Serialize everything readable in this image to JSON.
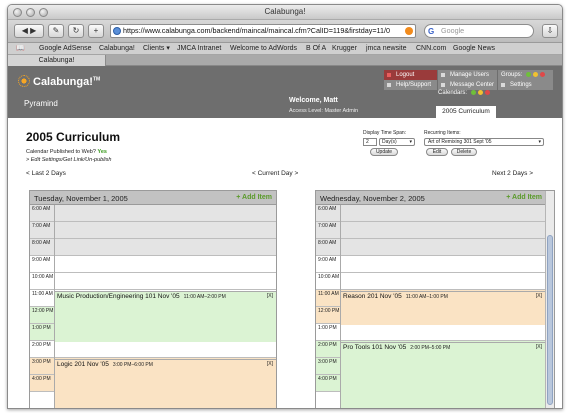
{
  "window": {
    "title": "Calabunga!"
  },
  "toolbar": {
    "url": "https://www.calabunga.com/backend/maincal/maincal.cfm?CalID=119&firstday=11/0",
    "search_placeholder": "Google"
  },
  "bookmarks": [
    "Google AdSense",
    "Calabunga!",
    "Clients ▾",
    "JMCA Intranet",
    "Welcome to AdWords",
    "B Of A",
    "Krugger",
    "jmca newsite",
    "CNN.com",
    "Google News"
  ],
  "tab": {
    "label": "Calabunga!"
  },
  "header": {
    "logo": "Calabunga!",
    "logo_tm": "TM",
    "org": "Pyramind",
    "welcome": "Welcome, Matt",
    "access": "Access Level: Master Admin",
    "menu": {
      "logout": "Logout",
      "help": "Help/Support",
      "manage_users": "Manage Users",
      "message_center": "Message Center",
      "groups": "Groups:",
      "settings": "Settings",
      "calendars": "Calendars:"
    },
    "current_calendar": "2005 Curriculum"
  },
  "main": {
    "title": "2005 Curriculum",
    "published_label": "Calendar Published to Web?",
    "published_value": "Yes",
    "edit_link": "> Edit Settings/Get Link/Un-publish",
    "display_span_label": "Display Time Span:",
    "display_span_num": "2",
    "display_span_unit": "Day(s)",
    "update_button": "Update",
    "recurring_label": "Recurring Items:",
    "recurring_value": "Art of Remixing 301 Sept '05",
    "edit_button": "Edit",
    "delete_button": "Delete",
    "nav_prev": "< Last 2 Days",
    "nav_current": "< Current Day >",
    "nav_next": "Next 2 Days >"
  },
  "days": [
    {
      "title": "Tuesday, November 1, 2005",
      "add_item": "+ Add Item",
      "times": [
        "6:00 AM",
        "7:00 AM",
        "8:00 AM",
        "9:00 AM",
        "10:00 AM",
        "11:00 AM",
        "12:00 PM",
        "1:00 PM",
        "2:00 PM",
        "3:00 PM",
        "4:00 PM"
      ],
      "events": [
        {
          "title": "Music Production/Engineering 101 Nov '05",
          "time": "11:00 AM–2:00 PM",
          "close": "[X]",
          "color": "green"
        },
        {
          "title": "Logic 201 Nov '05",
          "time": "3:00 PM–6:00 PM",
          "close": "[X]",
          "color": "orange"
        }
      ]
    },
    {
      "title": "Wednesday, November 2, 2005",
      "add_item": "+ Add Item",
      "times": [
        "6:00 AM",
        "7:00 AM",
        "8:00 AM",
        "9:00 AM",
        "10:00 AM",
        "11:00 AM",
        "12:00 PM",
        "1:00 PM",
        "2:00 PM",
        "3:00 PM",
        "4:00 PM"
      ],
      "events": [
        {
          "title": "Reason 201 Nov '05",
          "time": "11:00 AM–1:00 PM",
          "close": "[X]",
          "color": "orange"
        },
        {
          "title": "Pro Tools 101 Nov '05",
          "time": "2:00 PM–5:00 PM",
          "close": "[X]",
          "color": "green"
        }
      ]
    }
  ],
  "colors": {
    "add_item": "#5a9a2a",
    "published_yes": "#3a9a1e",
    "event_green": "#dbf3d3",
    "event_orange": "#fae3c4"
  }
}
